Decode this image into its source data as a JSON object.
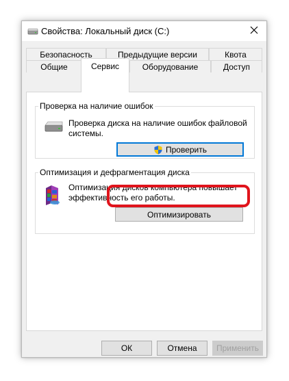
{
  "window": {
    "title": "Свойства: Локальный диск (C:)"
  },
  "tabs": {
    "row_top": [
      {
        "label": "Безопасность"
      },
      {
        "label": "Предыдущие версии"
      },
      {
        "label": "Квота"
      }
    ],
    "row_bottom": [
      {
        "label": "Общие"
      },
      {
        "label": "Сервис"
      },
      {
        "label": "Оборудование"
      },
      {
        "label": "Доступ"
      }
    ],
    "active": "Сервис"
  },
  "error_check": {
    "label": "Проверка на наличие ошибок",
    "description": "Проверка диска на наличие ошибок файловой системы.",
    "button_label": "Проверить",
    "icon": "drive-icon",
    "button_icon": "uac-shield-icon"
  },
  "optimize": {
    "label": "Оптимизация и дефрагментация диска",
    "description": "Оптимизация дисков компьютера повышает эффективность его работы.",
    "button_label": "Оптимизировать",
    "icon": "defrag-icon",
    "highlight_color": "#e0141c"
  },
  "footer": {
    "ok_label": "ОК",
    "cancel_label": "Отмена",
    "apply_label": "Применить",
    "apply_disabled": true
  },
  "colors": {
    "accent": "#0078d7",
    "window_bg": "#f0f0f0",
    "panel_bg": "#ffffff"
  }
}
